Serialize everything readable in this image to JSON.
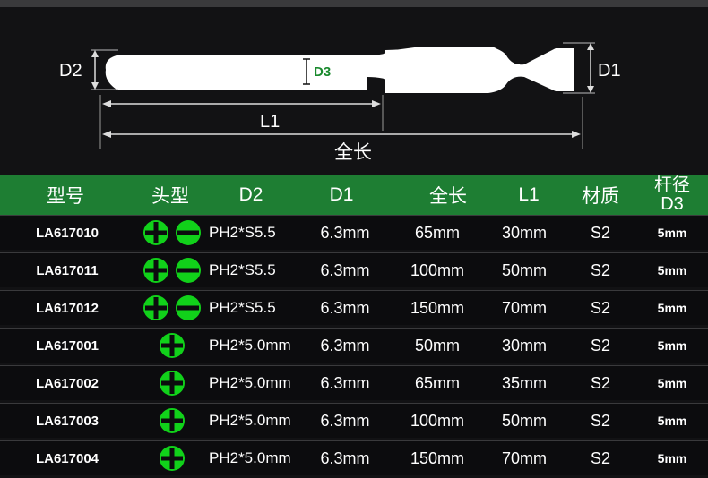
{
  "diagram": {
    "label_d2": "D2",
    "label_d3": "D3",
    "label_d1": "D1",
    "label_l1": "L1",
    "label_full": "全长"
  },
  "table": {
    "headers": {
      "model": "型号",
      "head_type": "头型",
      "d2": "D2",
      "d1": "D1",
      "full_length": "全长",
      "l1": "L1",
      "material": "材质",
      "shank_line1": "杆径",
      "shank_line2": "D3"
    },
    "rows": [
      {
        "model": "LA617010",
        "icons": [
          "phillips-icon",
          "slotted-icon"
        ],
        "d2": "PH2*S5.5",
        "d1": "6.3mm",
        "full": "65mm",
        "l1": "30mm",
        "material": "S2",
        "d3": "5mm"
      },
      {
        "model": "LA617011",
        "icons": [
          "phillips-icon",
          "slotted-icon"
        ],
        "d2": "PH2*S5.5",
        "d1": "6.3mm",
        "full": "100mm",
        "l1": "50mm",
        "material": "S2",
        "d3": "5mm"
      },
      {
        "model": "LA617012",
        "icons": [
          "phillips-icon",
          "slotted-icon"
        ],
        "d2": "PH2*S5.5",
        "d1": "6.3mm",
        "full": "150mm",
        "l1": "70mm",
        "material": "S2",
        "d3": "5mm"
      },
      {
        "model": "LA617001",
        "icons": [
          "phillips-icon"
        ],
        "d2": "PH2*5.0mm",
        "d1": "6.3mm",
        "full": "50mm",
        "l1": "30mm",
        "material": "S2",
        "d3": "5mm"
      },
      {
        "model": "LA617002",
        "icons": [
          "phillips-icon"
        ],
        "d2": "PH2*5.0mm",
        "d1": "6.3mm",
        "full": "65mm",
        "l1": "35mm",
        "material": "S2",
        "d3": "5mm"
      },
      {
        "model": "LA617003",
        "icons": [
          "phillips-icon"
        ],
        "d2": "PH2*5.0mm",
        "d1": "6.3mm",
        "full": "100mm",
        "l1": "50mm",
        "material": "S2",
        "d3": "5mm"
      },
      {
        "model": "LA617004",
        "icons": [
          "phillips-icon"
        ],
        "d2": "PH2*5.0mm",
        "d1": "6.3mm",
        "full": "150mm",
        "l1": "70mm",
        "material": "S2",
        "d3": "5mm"
      }
    ]
  },
  "colors": {
    "header_bg": "#1e7e33",
    "icon_green": "#11d11a",
    "d3_label": "#1a8a2e"
  }
}
